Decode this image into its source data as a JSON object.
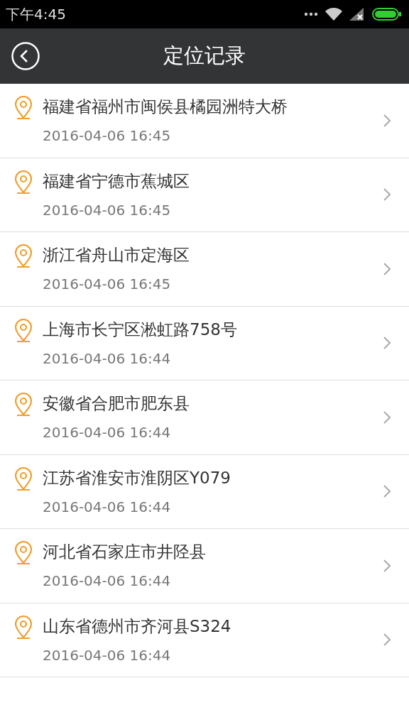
{
  "status_bar": {
    "time": "下午4:45"
  },
  "header": {
    "title": "定位记录"
  },
  "records": [
    {
      "place": "福建省福州市闽侯县橘园洲特大桥",
      "time": "2016-04-06 16:45"
    },
    {
      "place": "福建省宁德市蕉城区",
      "time": "2016-04-06 16:45"
    },
    {
      "place": "浙江省舟山市定海区",
      "time": "2016-04-06 16:45"
    },
    {
      "place": "上海市长宁区淞虹路758号",
      "time": "2016-04-06 16:44"
    },
    {
      "place": "安徽省合肥市肥东县",
      "time": "2016-04-06 16:44"
    },
    {
      "place": "江苏省淮安市淮阴区Y079",
      "time": "2016-04-06 16:44"
    },
    {
      "place": "河北省石家庄市井陉县",
      "time": "2016-04-06 16:44"
    },
    {
      "place": "山东省德州市齐河县S324",
      "time": "2016-04-06 16:44"
    }
  ]
}
